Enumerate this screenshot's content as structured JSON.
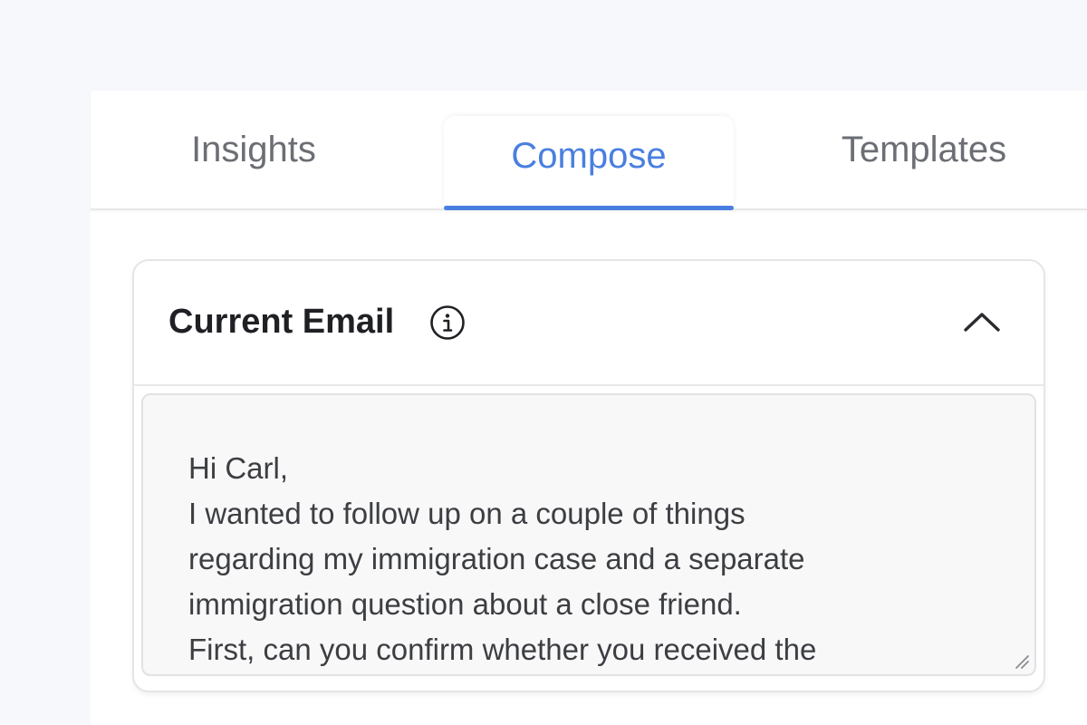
{
  "tabs": [
    {
      "label": "Insights",
      "active": false
    },
    {
      "label": "Compose",
      "active": true
    },
    {
      "label": "Templates",
      "active": false
    }
  ],
  "current_email": {
    "title": "Current Email",
    "info_icon": "info-icon",
    "collapse_icon": "chevron-up-icon",
    "body": "Hi Carl,\nI wanted to follow up on a couple of things\nregarding my immigration case and a separate\nimmigration question about a close friend.\nFirst, can you confirm whether you received the"
  },
  "colors": {
    "accent": "#4a7fe0",
    "tab_inactive": "#6b6e74",
    "background": "#f7f8fc"
  }
}
